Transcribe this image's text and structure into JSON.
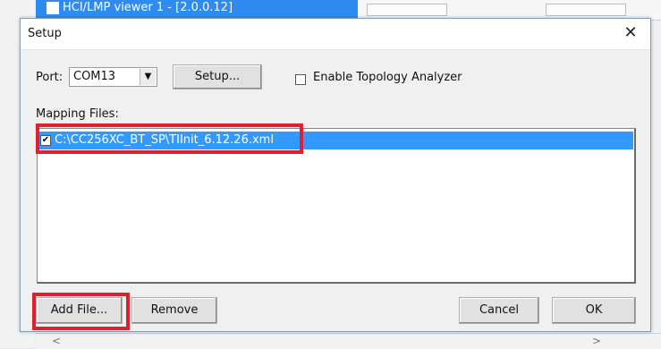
{
  "background_window": {
    "title": "HCI/LMP viewer 1 - [2.0.0.12]"
  },
  "dialog": {
    "title": "Setup",
    "close_symbol": "✕",
    "port": {
      "label": "Port:",
      "selected": "COM13",
      "arrow": "▼"
    },
    "setup_button": "Setup...",
    "topology": {
      "label": "Enable Topology Analyzer",
      "checked": false
    },
    "mapping_files": {
      "label": "Mapping Files:",
      "items": [
        {
          "path": "C:\\CC256XC_BT_SP\\TIInit_6.12.26.xml",
          "checked": true,
          "check_symbol": "✔"
        }
      ]
    },
    "buttons": {
      "add_file": "Add File...",
      "remove": "Remove",
      "cancel": "Cancel",
      "ok": "OK"
    }
  },
  "colors": {
    "highlight_box": "#e0202e",
    "selection": "#3399ff",
    "titlebar_bg": "#2f8bf0"
  },
  "icons": {
    "close": "close-icon",
    "dropdown": "chevron-down-icon",
    "checkbox": "checkbox-icon"
  }
}
